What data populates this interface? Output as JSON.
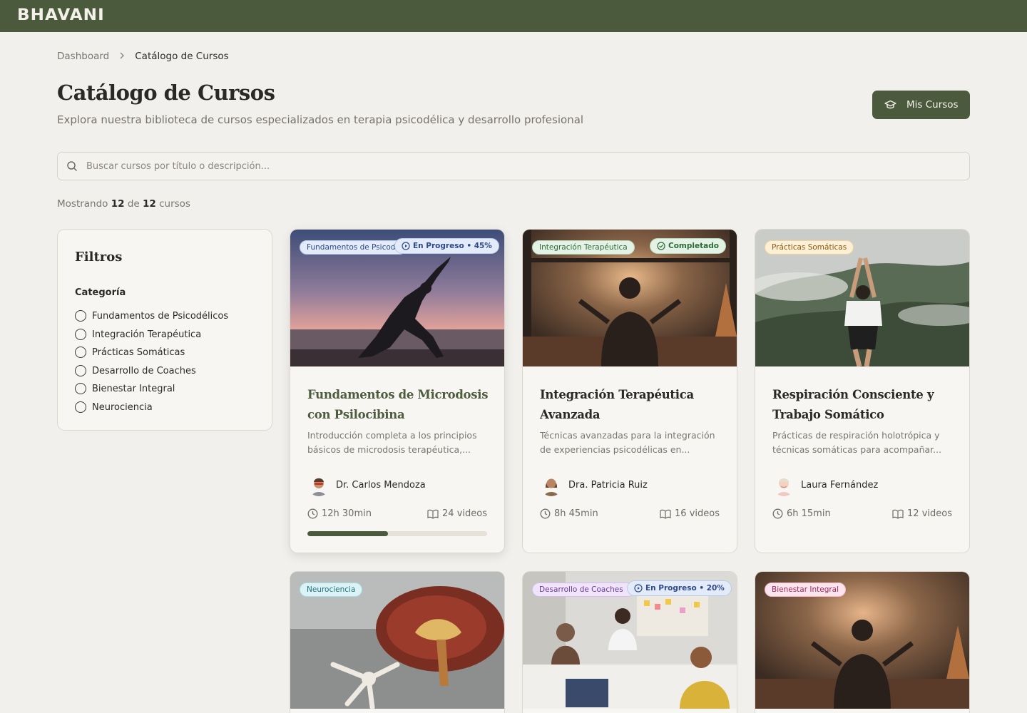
{
  "brand": {
    "logo": "BHAVANI"
  },
  "breadcrumb": {
    "items": [
      "Dashboard",
      "Catálogo de Cursos"
    ]
  },
  "header": {
    "title": "Catálogo de Cursos",
    "subtitle": "Explora nuestra biblioteca de cursos especializados en terapia psicodélica y desarrollo profesional",
    "my_courses_label": "Mis Cursos"
  },
  "search": {
    "placeholder": "Buscar cursos por título o descripción..."
  },
  "results": {
    "prefix": "Mostrando",
    "shown": "12",
    "middle": "de",
    "total": "12",
    "suffix": "cursos"
  },
  "filters": {
    "title": "Filtros",
    "category_label": "Categoría",
    "options": [
      "Fundamentos de Psicodélicos",
      "Integración Terapéutica",
      "Prácticas Somáticas",
      "Desarrollo de Coaches",
      "Bienestar Integral",
      "Neurociencia"
    ]
  },
  "colors": {
    "accent": "#4b5a3c",
    "background": "#f2f0ec"
  },
  "courses": [
    {
      "category": "Fundamentos de Psicodélicos",
      "status": "En Progreso • 45%",
      "progress": 0.45,
      "title": "Fundamentos de Microdosis con Psilocibina",
      "description": "Introducción completa a los principios básicos de microdosis terapéutica,...",
      "instructor": "Dr. Carlos Mendoza",
      "duration": "12h 30min",
      "videos": "24 videos"
    },
    {
      "category": "Integración Terapéutica",
      "status": "Completado",
      "title": "Integración Terapéutica Avanzada",
      "description": "Técnicas avanzadas para la integración de experiencias psicodélicas en...",
      "instructor": "Dra. Patricia Ruiz",
      "duration": "8h 45min",
      "videos": "16 videos"
    },
    {
      "category": "Prácticas Somáticas",
      "title": "Respiración Consciente y Trabajo Somático",
      "description": "Prácticas de respiración holotrópica y técnicas somáticas para acompañar...",
      "instructor": "Laura Fernández",
      "duration": "6h 15min",
      "videos": "12 videos"
    },
    {
      "category": "Neurociencia"
    },
    {
      "category": "Desarrollo de Coaches",
      "status": "En Progreso • 20%",
      "progress": 0.2
    },
    {
      "category": "Bienestar Integral"
    }
  ]
}
